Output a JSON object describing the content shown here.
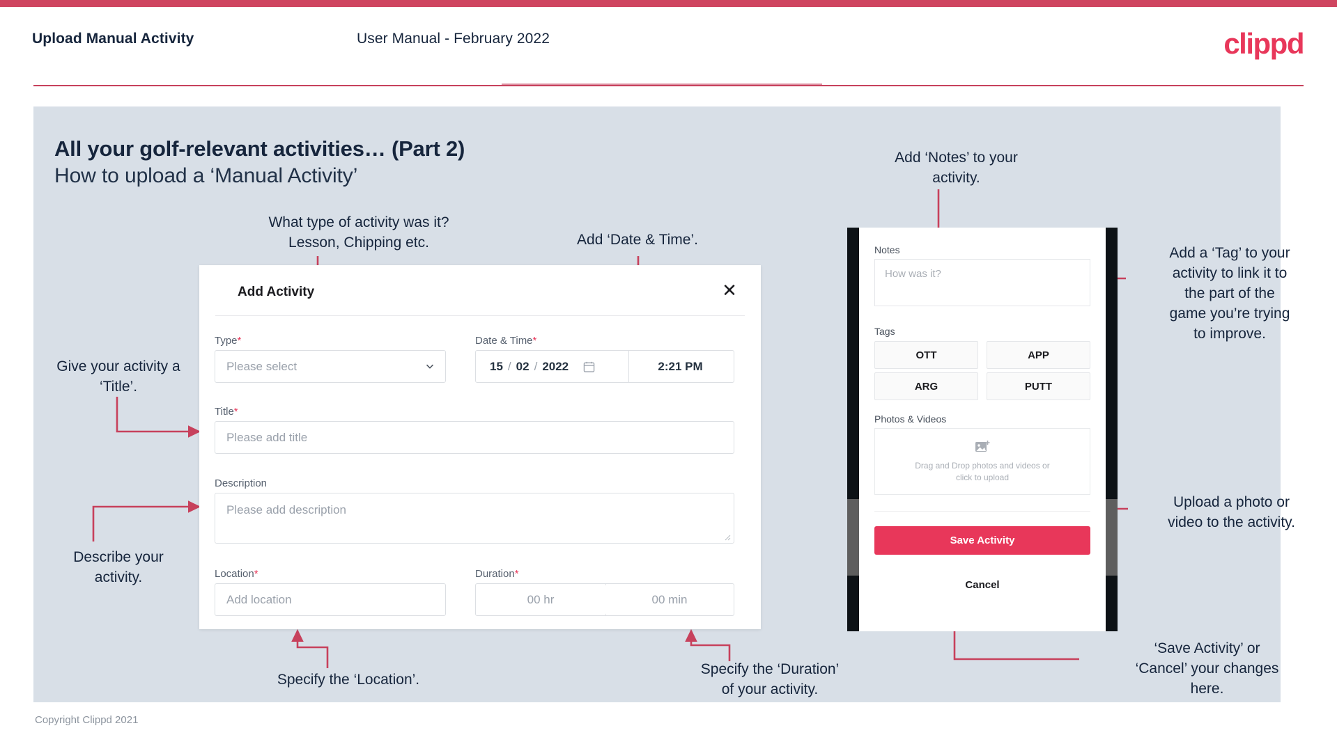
{
  "brand": {
    "logo_text": "clippd",
    "accent": "#e8375a",
    "bar_color": "#cf4560",
    "panel_bg": "#d8dfe7",
    "text_dark": "#16253c"
  },
  "header": {
    "title": "Upload Manual Activity",
    "subtitle": "User Manual - February 2022"
  },
  "deck": {
    "title_bold": "All your golf-relevant activities… (Part 2)",
    "title_light": "How to upload a ‘Manual Activity’"
  },
  "footer": {
    "copyright": "Copyright Clippd 2021"
  },
  "dialog": {
    "title": "Add Activity",
    "close_icon": "close-icon",
    "fields": {
      "type": {
        "label": "Type",
        "required": "*",
        "placeholder": "Please select",
        "chevron_icon": "chevron-down-icon"
      },
      "datetime": {
        "label": "Date & Time",
        "required": "*",
        "day": "15",
        "month": "02",
        "year": "2022",
        "sep": "/",
        "calendar_icon": "calendar-icon",
        "time": "2:21 PM"
      },
      "title": {
        "label": "Title",
        "required": "*",
        "placeholder": "Please add title"
      },
      "description": {
        "label": "Description",
        "required": "",
        "placeholder": "Please add description"
      },
      "location": {
        "label": "Location",
        "required": "*",
        "placeholder": "Add location"
      },
      "duration": {
        "label": "Duration",
        "required": "*",
        "hours": "00 hr",
        "minutes": "00 min"
      }
    }
  },
  "phone": {
    "notes": {
      "label": "Notes",
      "placeholder": "How was it?"
    },
    "tags": {
      "label": "Tags",
      "items": [
        "OTT",
        "APP",
        "ARG",
        "PUTT"
      ]
    },
    "photos": {
      "label": "Photos & Videos",
      "icon": "image-add-icon",
      "drop_line1": "Drag and Drop photos and videos or",
      "drop_line2": "click to upload"
    },
    "save_label": "Save Activity",
    "cancel_label": "Cancel"
  },
  "annotations": {
    "type": "What type of activity was it?\nLesson, Chipping etc.",
    "datetime": "Add ‘Date & Time’.",
    "title": "Give your activity a\n‘Title’.",
    "description": "Describe your\nactivity.",
    "location": "Specify the ‘Location’.",
    "duration": "Specify the ‘Duration’\nof your activity.",
    "notes": "Add ‘Notes’ to your\nactivity.",
    "tags": "Add a ‘Tag’ to your\nactivity to link it to\nthe part of the\ngame you’re trying\nto improve.",
    "upload": "Upload a photo or\nvideo to the activity.",
    "save": "‘Save Activity’ or\n‘Cancel’ your changes\nhere."
  }
}
